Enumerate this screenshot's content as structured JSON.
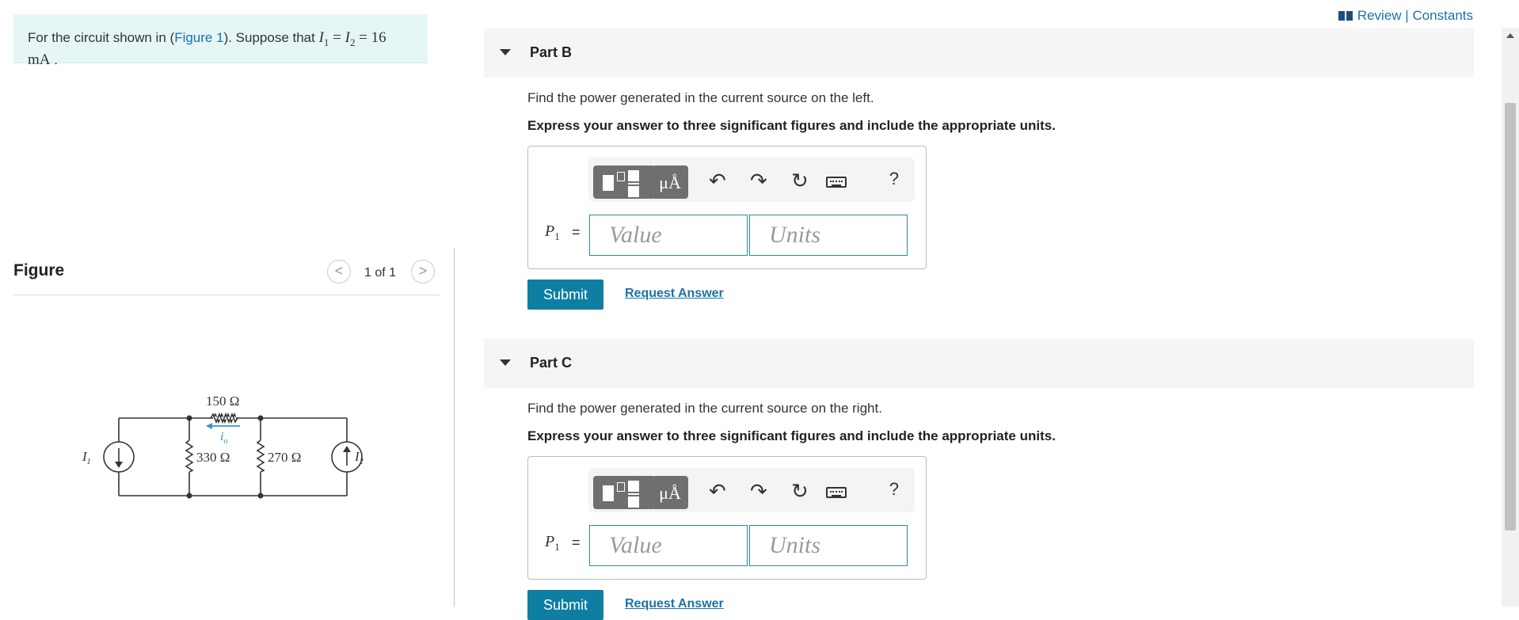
{
  "prompt": {
    "text_before": "For the circuit shown in (",
    "figure_link": "Figure 1",
    "text_after": "). Suppose that ",
    "i1": "I",
    "i1_sub": "1",
    "eq1": " = ",
    "i2": "I",
    "i2_sub": "2",
    "eq2": " = 16",
    "unit": "mA",
    "end": " ."
  },
  "figure": {
    "title": "Figure",
    "pager": "1 of 1",
    "prev_glyph": "<",
    "next_glyph": ">",
    "circuit": {
      "r_top": "150 Ω",
      "r_left": "330 Ω",
      "r_right": "270 Ω",
      "source_left": "I",
      "source_left_sub": "1",
      "source_right": "I",
      "source_right_sub": "2",
      "current": "i",
      "current_sub": "o"
    }
  },
  "header": {
    "review": "Review",
    "separator": " | ",
    "constants": "Constants"
  },
  "parts": [
    {
      "label": "Part B",
      "question": "Find the power generated in the current source on the left.",
      "instruction": "Express your answer to three significant figures and include the appropriate units.",
      "var": "P",
      "var_sub": "1",
      "eq": "=",
      "value_placeholder": "Value",
      "units_placeholder": "Units",
      "submit": "Submit",
      "request": "Request Answer"
    },
    {
      "label": "Part C",
      "question": "Find the power generated in the current source on the right.",
      "instruction": "Express your answer to three significant figures and include the appropriate units.",
      "var": "P",
      "var_sub": "1",
      "eq": "=",
      "value_placeholder": "Value",
      "units_placeholder": "Units",
      "submit": "Submit",
      "request": "Request Answer"
    }
  ],
  "toolbar": {
    "units_glyph": "μÅ",
    "undo_glyph": "↶",
    "redo_glyph": "↷",
    "reset_glyph": "↻",
    "help_glyph": "?"
  },
  "colors": {
    "accent": "#0f7ea3",
    "link": "#1a73a8",
    "prompt_bg": "#e6f6f7"
  }
}
